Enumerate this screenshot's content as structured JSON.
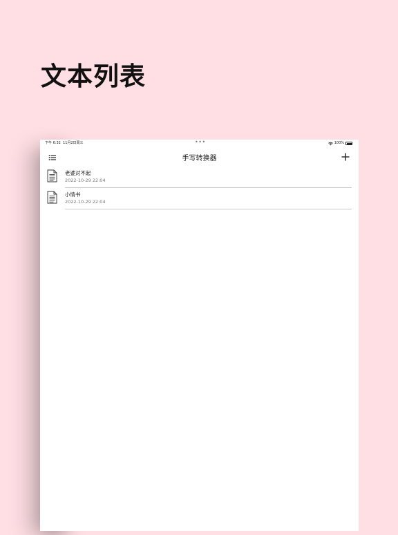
{
  "hero": {
    "title": "文本列表"
  },
  "status_bar": {
    "time": "下午 6:32",
    "date": "11月2日周三",
    "dots": "•••",
    "battery": "100%"
  },
  "nav": {
    "title": "手写转换器"
  },
  "icons": {
    "menu": "list-icon",
    "add": "plus-icon",
    "document": "document-icon",
    "wifi": "wifi-icon",
    "battery": "battery-icon"
  },
  "documents": [
    {
      "title": "老婆对不起",
      "date": "2022-10-29 22:04"
    },
    {
      "title": "小情书",
      "date": "2022-10-29 22:04"
    }
  ],
  "colors": {
    "background": "#ffdfe4",
    "surface": "#ffffff"
  }
}
